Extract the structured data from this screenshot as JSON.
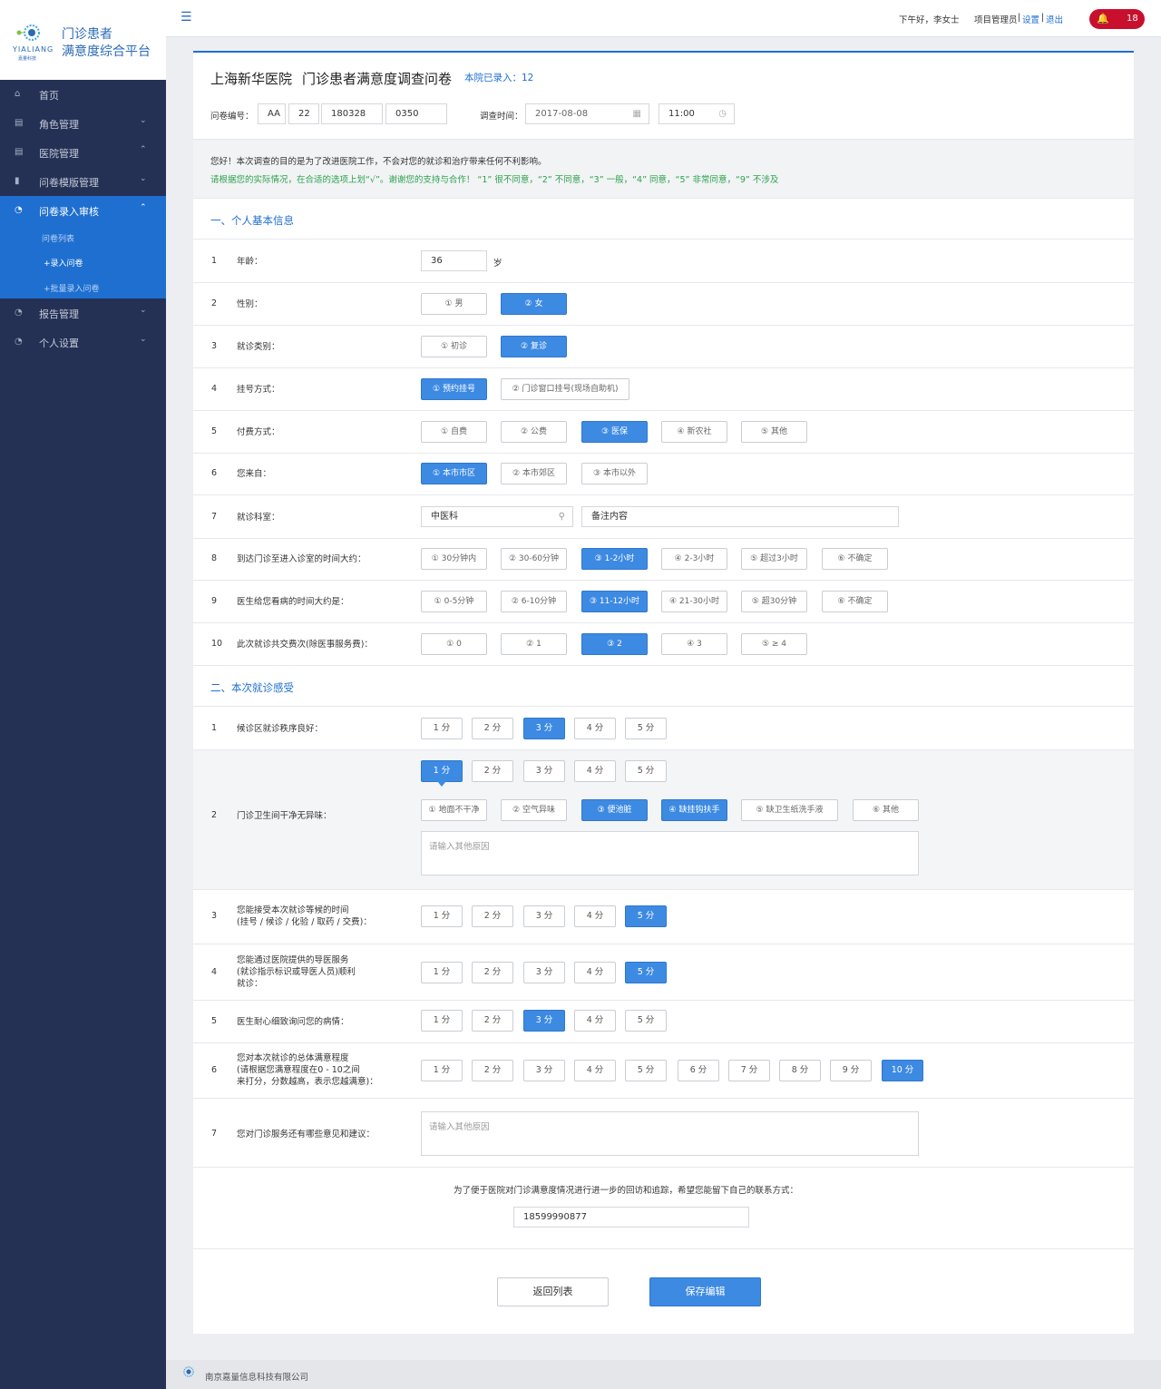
{
  "brand": {
    "line1": "门诊患者",
    "line2": "满意度综合平台",
    "logo_en": "YIALIANG",
    "logo_cn": "嘉量科技"
  },
  "sidebar": {
    "items": [
      {
        "label": "首页",
        "icon": "home-icon"
      },
      {
        "label": "角色管理",
        "icon": "document-icon"
      },
      {
        "label": "医院管理",
        "icon": "document-icon"
      },
      {
        "label": "问卷模版管理",
        "icon": "bar-chart-icon"
      },
      {
        "label": "问卷录入审核",
        "icon": "dashboard-icon"
      },
      {
        "label": "报告管理",
        "icon": "dashboard-icon"
      },
      {
        "label": "个人设置",
        "icon": "dashboard-icon"
      }
    ],
    "subitems": [
      "问卷列表",
      "+录入问卷",
      "+批量录入问卷"
    ]
  },
  "topbar": {
    "greeting": "下午好，李女士",
    "role": "项目管理员",
    "settings": "设置",
    "logout": "退出",
    "notif_count": "18",
    "sep": "|"
  },
  "header": {
    "hospital": "上海新华医院",
    "title": "门诊患者满意度调查问卷",
    "count": "本院已录入：12",
    "code_label": "问卷编号：",
    "code_values": [
      "AA",
      "22",
      "180328",
      "0350"
    ],
    "time_label": "调查时间：",
    "date": "2017-08-08",
    "time": "11:00"
  },
  "intro": {
    "line1": "您好！本次调查的目的是为了改进医院工作，不会对您的就诊和治疗带来任何不利影响。",
    "line2": "请根据您的实际情况，在合适的选项上划“√”。谢谢您的支持与合作！ “1” 很不同意，“2” 不同意，“3” 一般，“4” 同意，“5” 非常同意，“9” 不涉及"
  },
  "section1": {
    "title": "一、个人基本信息",
    "questions": [
      {
        "num": "1",
        "label": "年龄：",
        "value": "36",
        "unit": "岁"
      },
      {
        "num": "2",
        "label": "性别：",
        "options": [
          "① 男",
          "② 女"
        ],
        "selected": [
          1
        ]
      },
      {
        "num": "3",
        "label": "就诊类别：",
        "options": [
          "① 初诊",
          "② 复诊"
        ],
        "selected": [
          1
        ]
      },
      {
        "num": "4",
        "label": "挂号方式：",
        "options": [
          "① 预约挂号",
          "② 门诊窗口挂号(现场自助机)"
        ],
        "selected": [
          0
        ]
      },
      {
        "num": "5",
        "label": "付费方式：",
        "options": [
          "① 自费",
          "② 公费",
          "③ 医保",
          "④ 新农社",
          "⑤ 其他"
        ],
        "selected": [
          2
        ]
      },
      {
        "num": "6",
        "label": "您来自：",
        "options": [
          "① 本市市区",
          "② 本市郊区",
          "③ 本市以外"
        ],
        "selected": [
          0
        ]
      },
      {
        "num": "7",
        "label": "就诊科室：",
        "dept": "中医科",
        "remark": "备注内容"
      },
      {
        "num": "8",
        "label": "到达门诊至进入诊室的时间大约：",
        "options": [
          "① 30分钟内",
          "② 30-60分钟",
          "③ 1-2小时",
          "④ 2-3小时",
          "⑤ 超过3小时",
          "⑥ 不确定"
        ],
        "selected": [
          2
        ]
      },
      {
        "num": "9",
        "label": "医生给您看病的时间大约是：",
        "options": [
          "① 0-5分钟",
          "② 6-10分钟",
          "③ 11-12小时",
          "④ 21-30小时",
          "⑤ 超30分钟",
          "⑥ 不确定"
        ],
        "selected": [
          2
        ]
      },
      {
        "num": "10",
        "label": "此次就诊共交费次(除医事服务费)：",
        "options": [
          "① 0",
          "② 1",
          "③ 2",
          "④ 3",
          "⑤ ≥ 4"
        ],
        "selected": [
          2
        ]
      }
    ]
  },
  "section2": {
    "title": "二、本次就诊感受",
    "questions": [
      {
        "num": "1",
        "label": "候诊区就诊秩序良好：",
        "scores": [
          "1 分",
          "2 分",
          "3 分",
          "4 分",
          "5 分"
        ],
        "selected": 2
      },
      {
        "num": "2",
        "label": "门诊卫生间干净无异味：",
        "scores": [
          "1 分",
          "2 分",
          "3 分",
          "4 分",
          "5 分"
        ],
        "selected": 0,
        "reasons": [
          "① 地面不干净",
          "② 空气异味",
          "③ 便池脏",
          "④ 缺挂钩扶手",
          "⑤ 缺卫生纸洗手液",
          "⑥ 其他"
        ],
        "reasons_selected": [
          2,
          3
        ],
        "reason_placeholder": "请输入其他原因"
      },
      {
        "num": "3",
        "label": "您能接受本次就诊等候的时间\n(挂号 / 候诊 / 化验 / 取药 / 交费)：",
        "scores": [
          "1 分",
          "2 分",
          "3 分",
          "4 分",
          "5 分"
        ],
        "selected": 4
      },
      {
        "num": "4",
        "label": "您能通过医院提供的导医服务\n(就诊指示标识或导医人员)顺利\n就诊：",
        "scores": [
          "1 分",
          "2 分",
          "3 分",
          "4 分",
          "5 分"
        ],
        "selected": 4
      },
      {
        "num": "5",
        "label": "医生耐心细致询问您的病情：",
        "scores": [
          "1 分",
          "2 分",
          "3 分",
          "4 分",
          "5 分"
        ],
        "selected": 2
      },
      {
        "num": "6",
        "label": "您对本次就诊的总体满意程度\n(请根据您满意程度在0 - 10之间\n来打分，分数越高，表示您越满意)：",
        "scores": [
          "1 分",
          "2 分",
          "3 分",
          "4 分",
          "5 分",
          "6 分",
          "7 分",
          "8 分",
          "9 分",
          "10 分"
        ],
        "selected": 9
      },
      {
        "num": "7",
        "label": "您对门诊服务还有哪些意见和建议：",
        "placeholder": "请输入其他原因"
      }
    ]
  },
  "contact": {
    "label": "为了便于医院对门诊满意度情况进行进一步的回访和追踪，希望您能留下自己的联系方式：",
    "phone": "18599990877"
  },
  "actions": {
    "back": "返回列表",
    "save": "保存编辑"
  },
  "footer": {
    "company": "南京嘉量信息科技有限公司"
  },
  "colors": {
    "primary": "#1e6fd0",
    "sidebar": "#243155",
    "selected": "#3d8ae3",
    "bell": "#c8102e",
    "green": "#2ba24c"
  }
}
